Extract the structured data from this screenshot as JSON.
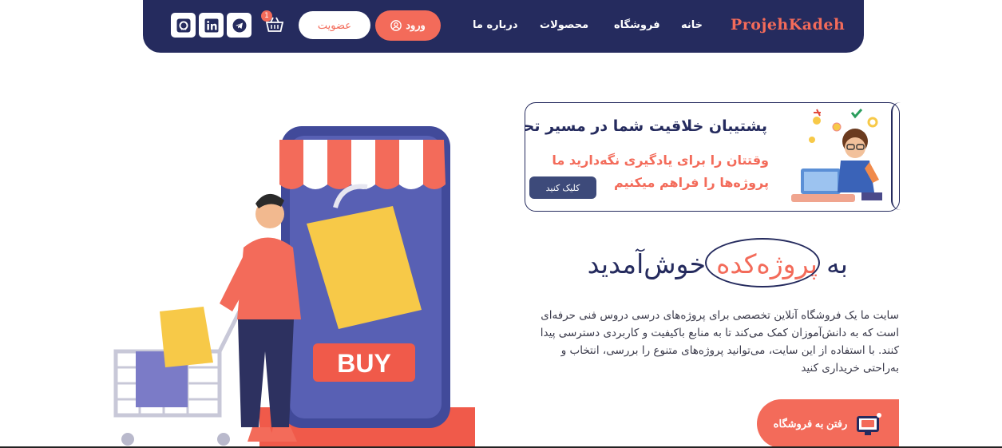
{
  "nav": {
    "logo": "ProjehKadeh",
    "links": [
      "خانه",
      "فروشگاه",
      "محصولات",
      "درباره ما"
    ],
    "login_label": "ورود",
    "signup_label": "عضویت",
    "cart_count": "1",
    "social_icons": [
      "github-icon",
      "linkedin-icon",
      "telegram-icon"
    ]
  },
  "banner": {
    "line1": "پشتیبان خلاقیت شما در مسیر تحصیل",
    "line2": "وقتتان را برای یادگیری نگه‌دارید ما",
    "line3": "پروژه‌ها را فراهم میکنیم",
    "button": "کلیک کنید"
  },
  "hero": {
    "welcome_prefix": "به",
    "brand": "پروژه‌کده",
    "welcome_suffix": "خوش‌آمدید",
    "description": "سایت ما یک فروشگاه آنلاین تخصصی برای پروژه‌های درسی دروس فنی حرفه‌ای است که به دانش‌آموزان کمک می‌کند تا به منابع باکیفیت و کاربردی دسترسی پیدا کنند. با استفاده از این سایت، می‌توانید پروژه‌های متنوع را بررسی، انتخاب و به‌راحتی خریداری کنید",
    "shop_button": "رفتن به فروشگاه",
    "buy_label": "BUY"
  },
  "colors": {
    "primary": "#252b5e",
    "accent": "#f36b5a",
    "yellow": "#f7c948"
  }
}
